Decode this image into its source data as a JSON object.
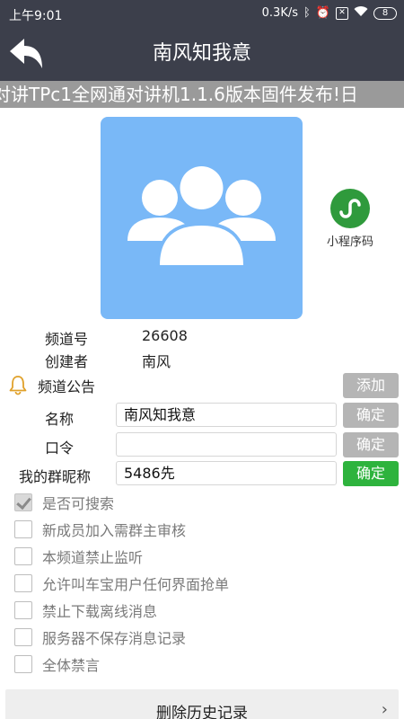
{
  "status_bar": {
    "time": "上午9:01",
    "speed": "0.3K/s",
    "battery": "8"
  },
  "header": {
    "title": "南风知我意"
  },
  "marquee": {
    "text": "对讲TPc1全网通对讲机1.1.6版本固件发布!日"
  },
  "mini_program": {
    "label": "小程序码"
  },
  "channel_info": {
    "channel_no_label": "频道号",
    "channel_no": "26608",
    "creator_label": "创建者",
    "creator": "南风"
  },
  "announcement": {
    "label": "频道公告",
    "add_label": "添加"
  },
  "form": {
    "name_label": "名称",
    "name_value": "南风知我意",
    "password_label": "口令",
    "password_value": "",
    "nickname_label": "我的群昵称",
    "nickname_value": "5486先",
    "confirm_label": "确定"
  },
  "options": [
    {
      "label": "是否可搜索",
      "checked": true
    },
    {
      "label": "新成员加入需群主审核",
      "checked": false
    },
    {
      "label": "本频道禁止监听",
      "checked": false
    },
    {
      "label": "允许叫车宝用户任何界面抢单",
      "checked": false
    },
    {
      "label": "禁止下载离线消息",
      "checked": false
    },
    {
      "label": "服务器不保存消息记录",
      "checked": false
    },
    {
      "label": "全体禁言",
      "checked": false
    }
  ],
  "bottom": {
    "delete_history_label": "删除历史记录"
  },
  "colors": {
    "title_bar": "#3c3f4b",
    "avatar_bg": "#79b8f7",
    "confirm_active": "#2eb33d",
    "button_disabled": "#b5b5b5",
    "mini_program": "#2f9a3c"
  }
}
